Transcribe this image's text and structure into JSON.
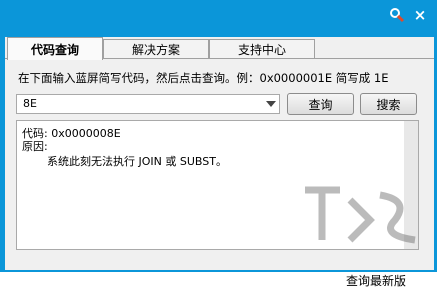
{
  "titlebar": {
    "search_icon": "magnifier-icon",
    "close_label": "×"
  },
  "tabs": [
    {
      "label": "代码查询",
      "active": true
    },
    {
      "label": "解决方案",
      "active": false
    },
    {
      "label": "支持中心",
      "active": false
    }
  ],
  "query": {
    "hint": "在下面输入蓝屏简写代码，然后点击查询。例：0x0000001E 简写成 1E",
    "input_value": "8E",
    "query_button": "查询",
    "search_button": "搜索"
  },
  "result": {
    "line1": "代码: 0x0000008E",
    "line2": "原因:",
    "line3": "系统此刻无法执行 JOIN 或 SUBST。"
  },
  "footer": {
    "update_link": "查询最新版"
  },
  "colors": {
    "window_border": "#0b96d9",
    "panel_bg": "#f0f0f0"
  }
}
